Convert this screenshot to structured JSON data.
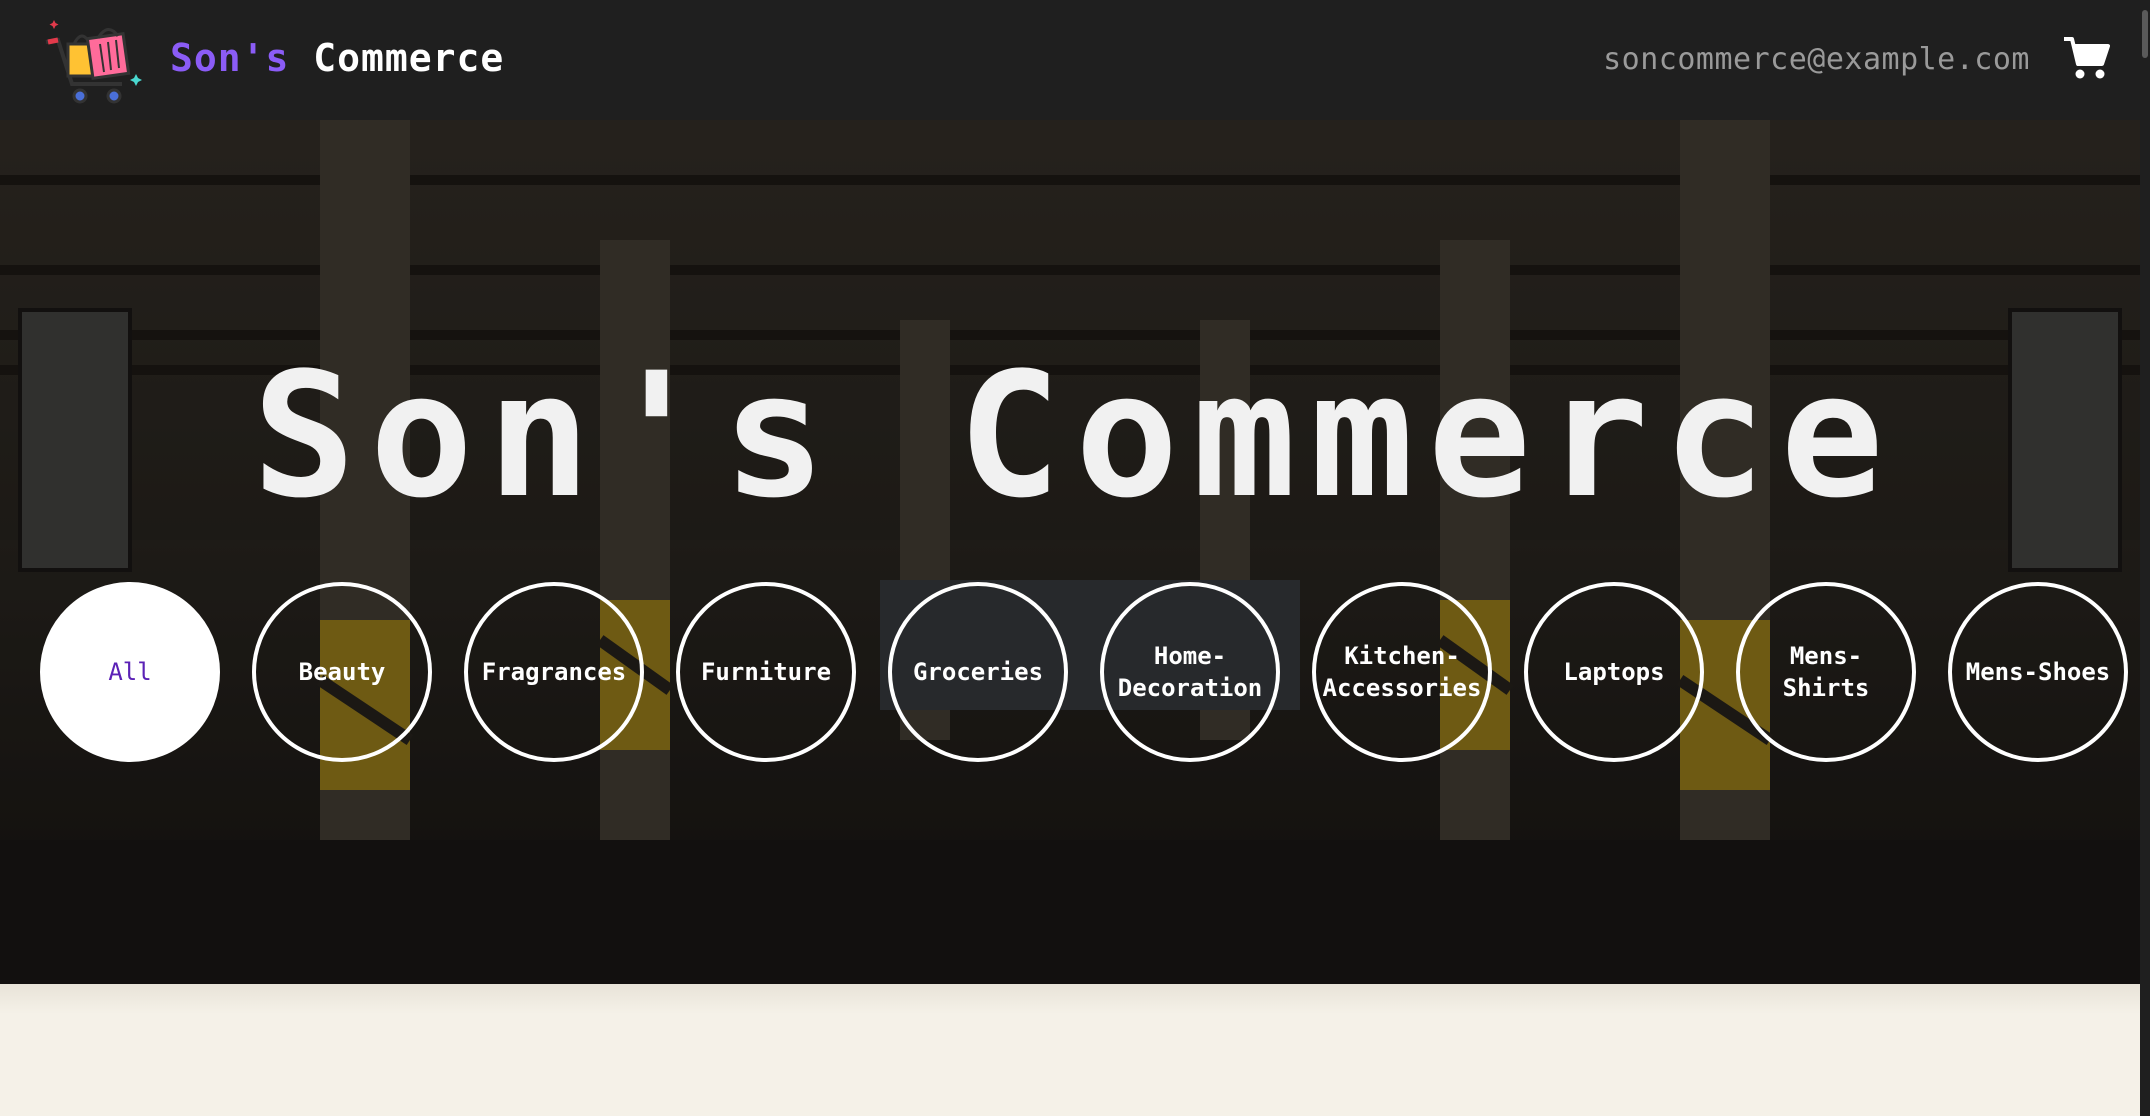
{
  "header": {
    "brand_first": "Son's",
    "brand_second": "Commerce",
    "email": "soncommerce@example.com",
    "cart_icon": "shopping-cart-icon",
    "logo_icon": "shopping-cart-logo-icon"
  },
  "hero": {
    "title": "Son's Commerce",
    "categories": [
      {
        "label": "All",
        "active": true
      },
      {
        "label": "Beauty"
      },
      {
        "label": "Fragrances"
      },
      {
        "label": "Furniture"
      },
      {
        "label": "Groceries"
      },
      {
        "label": "Home-\nDecoration"
      },
      {
        "label": "Kitchen-\nAccessories"
      },
      {
        "label": "Laptops"
      },
      {
        "label": "Mens-\nShirts"
      },
      {
        "label": "Mens-Shoes"
      }
    ]
  },
  "colors": {
    "brand_accent": "#8b5cf6",
    "header_bg": "#1f1f1f",
    "page_bg": "#f5f1e8"
  }
}
